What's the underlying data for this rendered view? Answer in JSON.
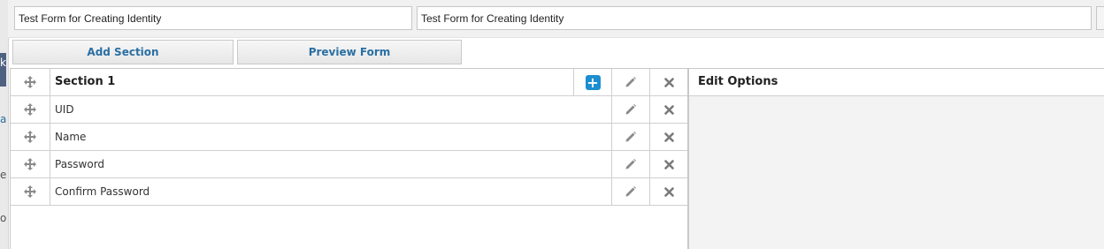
{
  "form": {
    "name_value": "Test Form for Creating Identity",
    "description_value": "Test Form for Creating Identity"
  },
  "toolbar": {
    "add_section_label": "Add Section",
    "preview_form_label": "Preview Form"
  },
  "left_strip_chars": [
    "k",
    "a",
    "e",
    "o"
  ],
  "section": {
    "title": "Section 1",
    "fields": [
      {
        "label": "UID"
      },
      {
        "label": "Name"
      },
      {
        "label": "Password"
      },
      {
        "label": "Confirm Password"
      }
    ]
  },
  "edit_options": {
    "title": "Edit Options"
  },
  "colors": {
    "accent": "#1c8ed0",
    "button_text": "#2a6fa3",
    "icon_gray": "#7a7a7a"
  },
  "icons": [
    "move-icon",
    "plus-icon",
    "pencil-icon",
    "close-icon"
  ]
}
